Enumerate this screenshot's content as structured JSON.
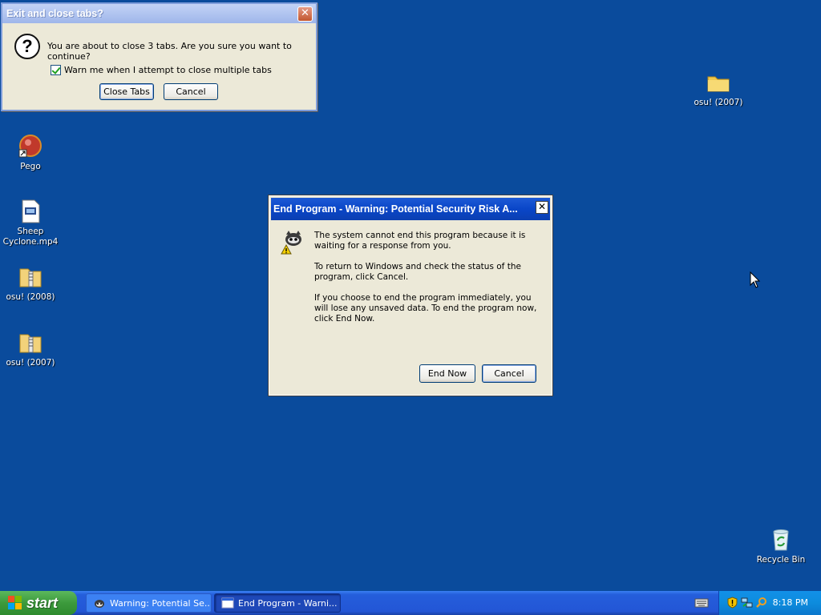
{
  "desktop": {
    "icons": [
      {
        "label": "osu! (2007)"
      },
      {
        "label": "Pego"
      },
      {
        "label": "Sheep Cyclone.mp4"
      },
      {
        "label": "osu! (2008)"
      },
      {
        "label": "osu! (2007)"
      },
      {
        "label": "Recycle Bin"
      }
    ]
  },
  "close_tabs_dialog": {
    "title": "Exit and close tabs?",
    "message": "You are about to close 3 tabs. Are you sure you want to continue?",
    "checkbox_label": "Warn me when I attempt to close multiple tabs",
    "checkbox_checked": true,
    "close_tabs_label": "Close Tabs",
    "cancel_label": "Cancel",
    "close_glyph": "✕"
  },
  "end_program_dialog": {
    "title": "End Program - Warning: Potential Security Risk A...",
    "paragraph1": "The system cannot end this program because it is waiting for a response from you.",
    "paragraph2": "To return to Windows and check the status of the program, click Cancel.",
    "paragraph3": "If you choose to end the program immediately, you will lose any unsaved data. To end the program now, click End Now.",
    "end_now_label": "End Now",
    "cancel_label": "Cancel",
    "close_glyph": "✕"
  },
  "taskbar": {
    "start_label": "start",
    "tasks": [
      {
        "label": "Warning: Potential Se..."
      },
      {
        "label": "End Program - Warni..."
      }
    ],
    "clock": "8:18 PM"
  },
  "colors": {
    "desktop_bg": "#0a4b9c",
    "dialog_bg": "#ece9d8",
    "title_active": "#0a46c8"
  }
}
